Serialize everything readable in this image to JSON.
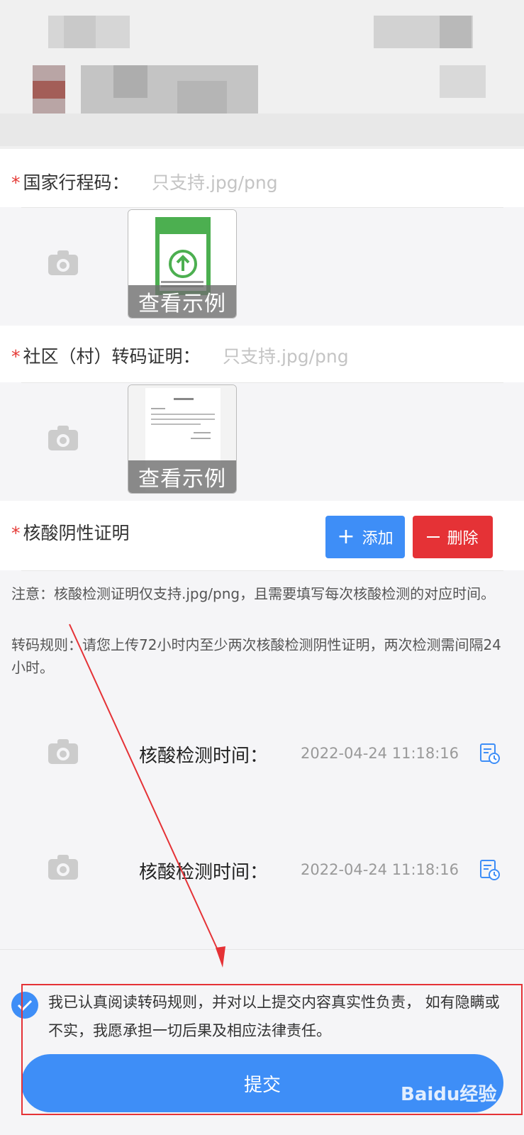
{
  "fields": {
    "itinerary": {
      "label": "国家行程码：",
      "hint": "只支持.jpg/png",
      "example": "查看示例"
    },
    "community": {
      "label": "社区（村）转码证明：",
      "hint": "只支持.jpg/png",
      "example": "查看示例"
    },
    "nucleic": {
      "label": "核酸阴性证明"
    }
  },
  "required_mark": "*",
  "buttons": {
    "add": "添加",
    "delete": "删除",
    "submit": "提交"
  },
  "notice": {
    "note": "注意：核酸检测证明仅支持.jpg/png，且需要填写每次核酸检测的对应时间。",
    "rule": "转码规则：请您上传72小时内至少两次核酸检测阴性证明，两次检测需间隔24小时。"
  },
  "tests": [
    {
      "label": "核酸检测时间：",
      "time": "2022-04-24 11:18:16"
    },
    {
      "label": "核酸检测时间：",
      "time": "2022-04-24 11:18:16"
    }
  ],
  "agreement": "我已认真阅读转码规则，并对以上提交内容真实性负责， 如有隐瞒或不实，我愿承担一切后果及相应法律责任。",
  "watermark": "Baidu经验",
  "colors": {
    "primary": "#3e8ef7",
    "danger": "#e53236",
    "required": "#e53935"
  }
}
